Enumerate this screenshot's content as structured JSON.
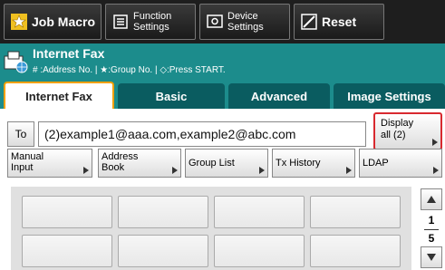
{
  "toolbar": {
    "job_macro": "Job Macro",
    "function_settings": [
      "Function",
      "Settings"
    ],
    "device_settings": [
      "Device",
      "Settings"
    ],
    "reset": "Reset"
  },
  "header": {
    "title": "Internet Fax",
    "subtitle": "# :Address No. | ★:Group No. | ◇:Press START."
  },
  "tabs": [
    {
      "label": "Internet Fax",
      "active": true
    },
    {
      "label": "Basic",
      "active": false
    },
    {
      "label": "Advanced",
      "active": false
    },
    {
      "label": "Image Settings",
      "active": false
    }
  ],
  "destination": {
    "to_label": "To",
    "value": "(2)example1@aaa.com,example2@abc.com"
  },
  "display_all": [
    "Display",
    "all (2)"
  ],
  "options": [
    [
      "Manual",
      "Input"
    ],
    [
      "Address",
      "Book"
    ],
    [
      "Group List"
    ],
    [
      "Tx History"
    ],
    [
      "LDAP"
    ]
  ],
  "pager": {
    "current": "1",
    "total": "5"
  },
  "colors": {
    "teal": "#1c8c8c",
    "tab_dark": "#0a5c60",
    "highlight": "#d8292f",
    "active_tab_border": "#f0a000"
  }
}
